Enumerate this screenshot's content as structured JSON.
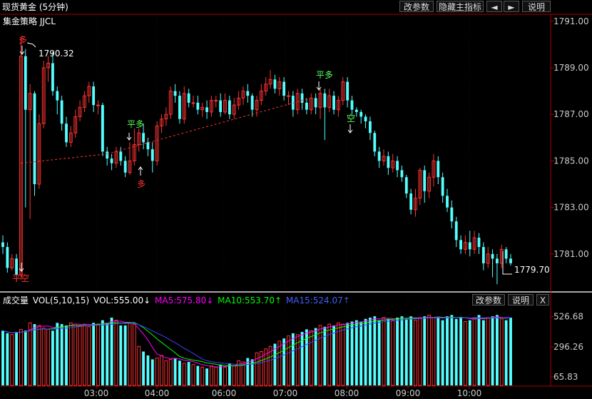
{
  "header": {
    "title": "现货黄金 (5分钟)",
    "strategy": "集金策略 JJCL",
    "buttons": [
      "改参数",
      "隐藏主指标",
      "◄",
      "►",
      "说明"
    ]
  },
  "volume_header": {
    "label": "成交量",
    "params": "VOL(5,10,15)",
    "vol": "VOL:555.00↓",
    "ma5": "MA5:575.80↓",
    "ma10": "MA10:553.70↑",
    "ma15": "MA15:524.07↑",
    "buttons": [
      "改参数",
      "说明",
      "X"
    ]
  },
  "colors": {
    "up": "#ff3232",
    "down": "#54ffff",
    "ma5": "#ff00ff",
    "ma10": "#00ff00",
    "ma15": "#4040ff",
    "dashed": "#ff3232",
    "axis": "#aa0000"
  },
  "chart_data": [
    {
      "type": "candlestick",
      "ylim": [
        1779.4,
        1791.3
      ],
      "yticks": [
        "1791.00",
        "1789.00",
        "1787.00",
        "1785.00",
        "1783.00",
        "1781.00"
      ],
      "xticks": [
        "03:00",
        "04:00",
        "06:00",
        "07:00",
        "08:00",
        "09:00",
        "10:00"
      ],
      "annotations": {
        "high_label": "1790.32",
        "low_label": "1779.70",
        "signals": [
          "多",
          "平空",
          "平多",
          "多",
          "平多",
          "空"
        ]
      },
      "candles": [
        [
          1781.5,
          1781.3,
          1781.8,
          1781.0
        ],
        [
          1781.3,
          1780.4,
          1781.5,
          1780.2
        ],
        [
          1780.4,
          1780.8,
          1781.0,
          1780.3
        ],
        [
          1780.8,
          1780.1,
          1781.0,
          1779.8
        ],
        [
          1780.1,
          1789.5,
          1790.3,
          1779.9
        ],
        [
          1789.5,
          1787.2,
          1789.8,
          1783.0
        ],
        [
          1787.2,
          1787.9,
          1788.3,
          1782.5
        ],
        [
          1787.9,
          1784.0,
          1788.0,
          1783.5
        ],
        [
          1784.0,
          1786.6,
          1787.0,
          1783.8
        ],
        [
          1786.6,
          1789.0,
          1789.3,
          1786.4
        ],
        [
          1789.0,
          1789.2,
          1789.5,
          1788.4
        ],
        [
          1789.2,
          1788.0,
          1789.7,
          1787.8
        ],
        [
          1788.0,
          1787.6,
          1788.2,
          1787.0
        ],
        [
          1787.6,
          1786.6,
          1787.8,
          1786.3
        ],
        [
          1786.6,
          1785.8,
          1786.9,
          1785.6
        ],
        [
          1785.8,
          1786.2,
          1786.5,
          1785.6
        ],
        [
          1786.2,
          1786.9,
          1787.2,
          1786.0
        ],
        [
          1786.9,
          1787.3,
          1787.6,
          1786.7
        ],
        [
          1787.3,
          1787.8,
          1788.0,
          1787.1
        ],
        [
          1787.8,
          1788.2,
          1788.4,
          1787.5
        ],
        [
          1788.2,
          1787.4,
          1788.4,
          1787.1
        ],
        [
          1787.4,
          1787.4,
          1787.6,
          1787.0
        ],
        [
          1787.4,
          1785.4,
          1787.5,
          1785.2
        ],
        [
          1785.4,
          1785.1,
          1785.6,
          1784.8
        ],
        [
          1785.1,
          1784.9,
          1785.3,
          1784.6
        ],
        [
          1784.9,
          1785.4,
          1785.6,
          1784.7
        ],
        [
          1785.4,
          1785.0,
          1785.6,
          1784.8
        ],
        [
          1785.0,
          1784.5,
          1785.2,
          1784.3
        ],
        [
          1784.5,
          1785.0,
          1785.8,
          1784.4
        ],
        [
          1785.0,
          1785.7,
          1786.4,
          1784.8
        ],
        [
          1785.7,
          1786.2,
          1786.4,
          1785.4
        ],
        [
          1786.2,
          1785.8,
          1786.6,
          1785.5
        ],
        [
          1785.8,
          1785.5,
          1786.0,
          1785.2
        ],
        [
          1785.5,
          1785.0,
          1785.8,
          1784.5
        ],
        [
          1785.0,
          1786.5,
          1786.7,
          1784.8
        ],
        [
          1786.5,
          1786.8,
          1787.0,
          1786.2
        ],
        [
          1786.8,
          1787.0,
          1787.3,
          1786.5
        ],
        [
          1787.0,
          1788.0,
          1788.2,
          1786.8
        ],
        [
          1788.0,
          1787.8,
          1788.3,
          1787.5
        ],
        [
          1787.8,
          1786.8,
          1788.0,
          1786.6
        ],
        [
          1786.8,
          1787.9,
          1788.2,
          1786.6
        ],
        [
          1787.9,
          1787.5,
          1788.1,
          1787.3
        ],
        [
          1787.5,
          1787.5,
          1787.8,
          1787.3
        ],
        [
          1787.5,
          1787.2,
          1787.8,
          1787.0
        ],
        [
          1787.2,
          1787.3,
          1787.5,
          1786.9
        ],
        [
          1787.3,
          1787.1,
          1787.6,
          1786.8
        ],
        [
          1787.1,
          1787.6,
          1787.8,
          1786.9
        ],
        [
          1787.6,
          1787.6,
          1787.8,
          1787.3
        ],
        [
          1787.6,
          1787.1,
          1787.9,
          1786.9
        ],
        [
          1787.1,
          1787.6,
          1787.9,
          1787.0
        ],
        [
          1787.6,
          1787.0,
          1787.8,
          1786.8
        ],
        [
          1787.0,
          1787.4,
          1787.7,
          1786.8
        ],
        [
          1787.4,
          1787.7,
          1788.0,
          1787.2
        ],
        [
          1787.7,
          1788.0,
          1788.2,
          1787.4
        ],
        [
          1788.0,
          1787.8,
          1788.3,
          1787.5
        ],
        [
          1787.8,
          1787.2,
          1787.9,
          1786.9
        ],
        [
          1787.2,
          1787.6,
          1787.8,
          1786.9
        ],
        [
          1787.6,
          1788.0,
          1788.3,
          1787.4
        ],
        [
          1788.0,
          1788.3,
          1788.6,
          1787.8
        ],
        [
          1788.3,
          1788.5,
          1788.9,
          1788.1
        ],
        [
          1788.5,
          1788.1,
          1788.7,
          1787.9
        ],
        [
          1788.1,
          1788.4,
          1788.6,
          1787.8
        ],
        [
          1788.4,
          1787.8,
          1788.6,
          1787.6
        ],
        [
          1787.8,
          1787.8,
          1788.0,
          1787.4
        ],
        [
          1787.8,
          1787.2,
          1788.0,
          1786.9
        ],
        [
          1787.2,
          1787.9,
          1788.1,
          1787.0
        ],
        [
          1787.9,
          1787.5,
          1788.1,
          1787.2
        ],
        [
          1787.5,
          1787.2,
          1787.7,
          1787.0
        ],
        [
          1787.2,
          1787.7,
          1787.9,
          1787.0
        ],
        [
          1787.7,
          1787.3,
          1787.9,
          1787.0
        ],
        [
          1787.3,
          1787.9,
          1788.1,
          1786.8
        ],
        [
          1787.9,
          1787.3,
          1788.1,
          1785.9
        ],
        [
          1787.3,
          1787.8,
          1788.1,
          1787.1
        ],
        [
          1787.8,
          1787.2,
          1788.0,
          1787.0
        ],
        [
          1787.2,
          1787.6,
          1787.8,
          1786.9
        ],
        [
          1787.6,
          1788.4,
          1788.6,
          1787.4
        ],
        [
          1788.4,
          1787.6,
          1788.6,
          1787.3
        ],
        [
          1787.6,
          1787.2,
          1787.8,
          1787.0
        ],
        [
          1787.2,
          1787.1,
          1787.3,
          1786.9
        ],
        [
          1787.1,
          1786.9,
          1787.2,
          1786.6
        ],
        [
          1786.9,
          1786.7,
          1787.0,
          1786.4
        ],
        [
          1786.7,
          1786.2,
          1786.9,
          1785.9
        ],
        [
          1786.2,
          1785.4,
          1786.3,
          1785.2
        ],
        [
          1785.4,
          1785.0,
          1785.6,
          1784.7
        ],
        [
          1785.0,
          1785.2,
          1785.5,
          1784.8
        ],
        [
          1785.2,
          1784.7,
          1785.4,
          1784.4
        ],
        [
          1784.7,
          1785.0,
          1785.3,
          1784.5
        ],
        [
          1785.0,
          1784.6,
          1785.2,
          1784.3
        ],
        [
          1784.6,
          1784.3,
          1784.8,
          1784.1
        ],
        [
          1784.3,
          1783.6,
          1784.4,
          1783.4
        ],
        [
          1783.6,
          1782.9,
          1783.8,
          1782.7
        ],
        [
          1782.9,
          1783.4,
          1783.8,
          1782.6
        ],
        [
          1783.4,
          1784.6,
          1784.7,
          1783.1
        ],
        [
          1784.6,
          1783.7,
          1784.8,
          1783.2
        ],
        [
          1783.7,
          1784.3,
          1784.5,
          1783.4
        ],
        [
          1784.3,
          1785.0,
          1785.3,
          1783.9
        ],
        [
          1785.0,
          1784.3,
          1785.2,
          1784.0
        ],
        [
          1784.3,
          1783.5,
          1784.5,
          1783.2
        ],
        [
          1783.5,
          1783.0,
          1783.8,
          1782.8
        ],
        [
          1783.0,
          1782.4,
          1783.3,
          1782.1
        ],
        [
          1782.4,
          1781.6,
          1782.6,
          1781.3
        ],
        [
          1781.6,
          1781.2,
          1781.8,
          1781.0
        ],
        [
          1781.2,
          1781.5,
          1781.8,
          1781.0
        ],
        [
          1781.5,
          1781.2,
          1782.0,
          1780.9
        ],
        [
          1781.2,
          1781.7,
          1782.0,
          1781.0
        ],
        [
          1781.7,
          1781.3,
          1781.9,
          1781.0
        ],
        [
          1781.3,
          1780.6,
          1781.5,
          1780.3
        ],
        [
          1780.6,
          1781.0,
          1781.3,
          1780.4
        ],
        [
          1781.0,
          1780.8,
          1781.2,
          1780.0
        ],
        [
          1780.8,
          1780.6,
          1781.0,
          1779.7
        ],
        [
          1780.6,
          1781.2,
          1781.4,
          1780.4
        ],
        [
          1781.2,
          1780.8,
          1781.3,
          1780.6
        ],
        [
          1780.8,
          1780.6,
          1781.0,
          1780.5
        ]
      ]
    },
    {
      "type": "bar",
      "title": "成交量",
      "ylim": [
        0,
        580
      ],
      "yticks": [
        "526.68",
        "296.26",
        "65.83"
      ],
      "values": [
        420,
        400,
        390,
        410,
        430,
        420,
        480,
        470,
        460,
        440,
        430,
        420,
        480,
        470,
        460,
        480,
        470,
        460,
        470,
        450,
        480,
        470,
        500,
        480,
        520,
        500,
        460,
        460,
        480,
        470,
        300,
        260,
        230,
        200,
        210,
        230,
        190,
        200,
        210,
        190,
        170,
        180,
        160,
        150,
        140,
        130,
        150,
        140,
        160,
        140,
        170,
        150,
        190,
        180,
        210,
        200,
        250,
        260,
        280,
        300,
        320,
        340,
        360,
        380,
        400,
        390,
        410,
        430,
        420,
        440,
        460,
        450,
        470,
        460,
        480,
        470,
        480,
        490,
        500,
        490,
        510,
        520,
        530,
        500,
        520,
        510,
        500,
        520,
        530,
        510,
        530,
        500,
        520,
        530,
        540,
        520,
        520,
        500,
        530,
        540,
        510,
        520,
        490,
        500,
        520,
        540,
        500,
        520,
        530,
        540,
        510,
        500,
        520,
        540,
        500,
        555,
        200
      ]
    }
  ]
}
